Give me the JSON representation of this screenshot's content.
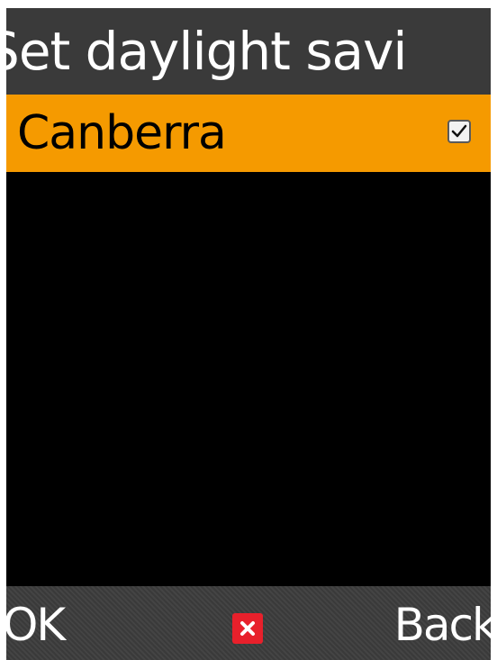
{
  "header": {
    "title": "Set daylight savi"
  },
  "list": {
    "items": [
      {
        "label": "Canberra",
        "checked": true
      }
    ]
  },
  "softkeys": {
    "left_label": "OK",
    "center_icon": "close-icon",
    "right_label": "Back"
  },
  "colors": {
    "selection": "#f59a00",
    "background": "#000000",
    "title_bar": "#3a3a3a",
    "center_key": "#e8202b"
  }
}
